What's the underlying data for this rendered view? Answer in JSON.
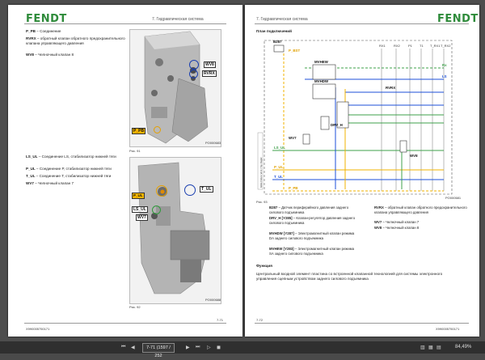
{
  "left_page": {
    "logo": "FENDT",
    "section": "7. Гидравлическая система",
    "legend_top": [
      {
        "code": "P_PB",
        "text": "Соединение"
      },
      {
        "code": "RVRX",
        "text": "обратный клапан обратного предохранительного клапана управляющего давления"
      },
      {
        "code": "WV8",
        "text": "Челночный клапан 8"
      }
    ],
    "photo1_labels": {
      "wv8": "WV8",
      "rvrx": "RVRX",
      "ppb": "P_PB"
    },
    "photo1_code": "PO000683",
    "fig1_caption": "Рис. 91",
    "legend_bottom": [
      {
        "code": "LS_UL",
        "text": "Соединение LS, стабилизатор нижней тяги"
      },
      {
        "code": "P_UL",
        "text": "Соединение P, стабилизатор нижней тяги"
      },
      {
        "code": "T_UL",
        "text": "Соединение T, стабилизатор нижней тяги"
      },
      {
        "code": "WV7",
        "text": "Челночный клапан 7"
      }
    ],
    "photo2_labels": {
      "tul": "T_UL",
      "lsul": "LS_UL",
      "pul": "P_UL",
      "wv7": "WV7"
    },
    "photo2_code": "PO000688",
    "fig2_caption": "Рис. 92",
    "page_number": "7-71",
    "doc_code": "X990005750171"
  },
  "right_page": {
    "logo": "FENDT",
    "section": "7. Гидравлическая система",
    "diagram_title": "План подключений",
    "diagram_code": "PO000681",
    "fig_caption": "Рис. 93",
    "diagram_labels": {
      "b287": "B287",
      "p_bst": "P_BST",
      "mvhew": "MVHEW",
      "mvhdw": "MVHDW",
      "rvrx": "RVRX",
      "drv_h": "DRV_H",
      "wv7": "WV7",
      "wv8": "WV8",
      "ls_ul": "LS_UL",
      "p_ul": "P_UL",
      "t_ul": "T_UL",
      "p_pb": "P_PB",
      "rx": "Rx",
      "ls": "LS",
      "side_label": "Glide Fixture Vent / Top Regler",
      "top_ports": [
        "RX1",
        "RX2",
        "P1",
        "T1",
        "T_RX1",
        "T_RX2"
      ]
    },
    "legend_left": [
      {
        "code": "B287",
        "text": "Датчик периферийного давления заднего силового подъемника"
      },
      {
        "code": "DRV_H [Y285]",
        "text": "Клапан-регулятор давления заднего силового подъемника"
      },
      {
        "code": "MVHDW [Y287]",
        "text": "Электромагнитный клапан режима DA заднего силового подъемника"
      },
      {
        "code": "MVHEW [Y283]",
        "text": "Электромагнитный клапан режима SA заднего силового подъемника"
      }
    ],
    "legend_right": [
      {
        "code": "RVRX",
        "text": "обратный клапан обратного предохранительного клапана управляющего давления"
      },
      {
        "code": "WV7",
        "text": "Челночный клапан 7"
      },
      {
        "code": "WV8",
        "text": "Челночный клапан 8"
      }
    ],
    "function_heading": "Функция",
    "function_text": "Центральный входной элемент пластина со встроенной клапанной технологией для системы электронного управления сцепным устройством заднего силового подъемника",
    "page_number": "7-72",
    "doc_code": "X990005750171"
  },
  "statusbar": {
    "page_field": "7-71 (1597 / 252",
    "zoom": "84,49%"
  }
}
